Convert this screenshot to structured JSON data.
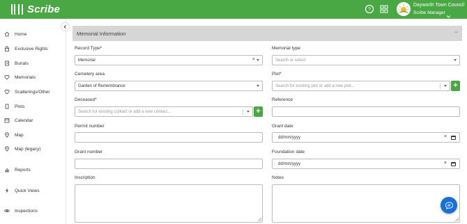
{
  "app": {
    "logo_text": "Scribe"
  },
  "header": {
    "council_name": "Dayworth Town Council",
    "user_role": "Scribe Manager"
  },
  "sidebar": {
    "items": [
      {
        "label": "Home",
        "icon": "home-icon"
      },
      {
        "label": "Exclusive Rights",
        "icon": "lock-icon"
      },
      {
        "label": "Burials",
        "icon": "book-icon"
      },
      {
        "label": "Memorials",
        "icon": "heart-icon"
      },
      {
        "label": "Scatterings/Other",
        "icon": "heart-outline-icon"
      },
      {
        "label": "Plots",
        "icon": "plot-icon"
      },
      {
        "label": "Calendar",
        "icon": "calendar-icon"
      },
      {
        "label": "Map",
        "icon": "map-pin-icon"
      },
      {
        "label": "Map (legacy)",
        "icon": "map-pin-icon"
      },
      {
        "label": "Reports",
        "icon": "bar-chart-icon"
      },
      {
        "label": "Quick Views",
        "icon": "lightning-icon"
      },
      {
        "label": "Inspections",
        "icon": "eye-icon"
      }
    ]
  },
  "section": {
    "title": "Memorial Information",
    "toggle": "−"
  },
  "form": {
    "record_type": {
      "label": "Record Type*",
      "value": "Memorial"
    },
    "memorial_type": {
      "label": "Memorial type",
      "placeholder": "Search or select"
    },
    "cemetery_area": {
      "label": "Cemetery area",
      "value": "Garden of Remembrance"
    },
    "plot": {
      "label": "Plot*",
      "placeholder": "Search for existing plot or add a new plot..."
    },
    "deceased": {
      "label": "Deceased*",
      "placeholder": "Search for existing contact or add a new contact..."
    },
    "reference": {
      "label": "Reference",
      "value": ""
    },
    "permit_number": {
      "label": "Permit number",
      "value": ""
    },
    "grant_date": {
      "label": "Grant date",
      "placeholder": "dd/mm/yyyy"
    },
    "grant_number": {
      "label": "Grant number",
      "value": ""
    },
    "foundation_date": {
      "label": "Foundation date",
      "placeholder": "dd/mm/yyyy"
    },
    "inscription": {
      "label": "Inscription"
    },
    "notes": {
      "label": "Notes"
    }
  },
  "colors": {
    "brand_green": "#4aa844",
    "chat_blue": "#1a6fd6",
    "section_header": "#d6d6d6"
  }
}
